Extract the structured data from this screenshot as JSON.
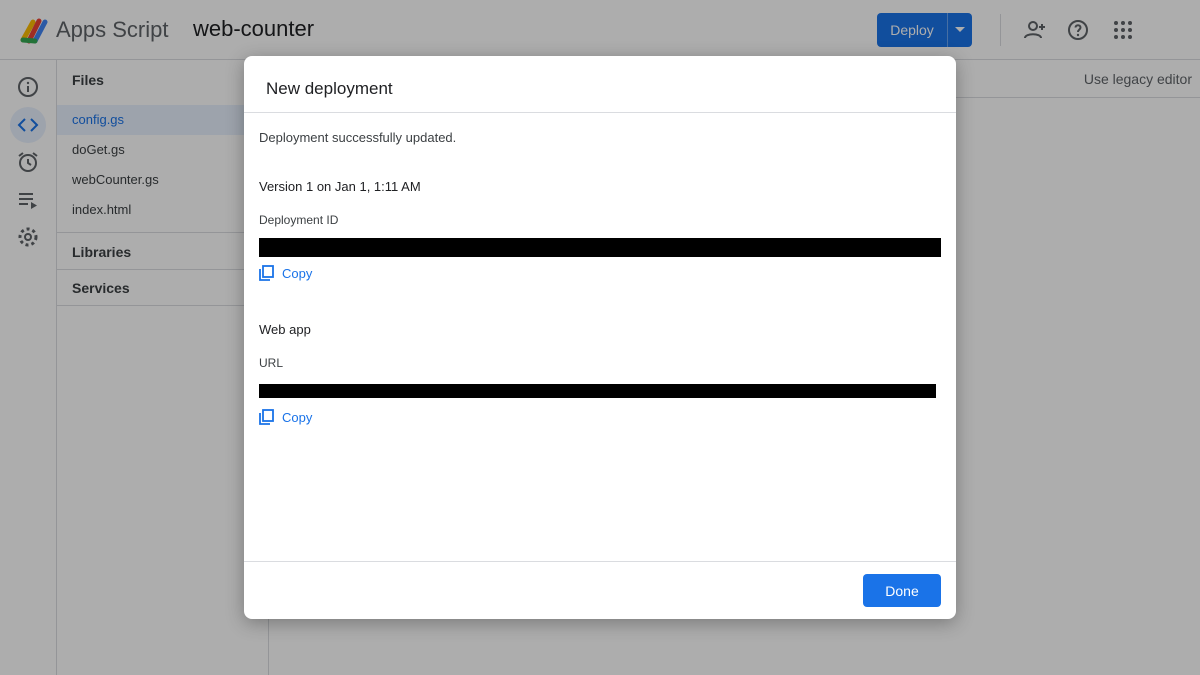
{
  "header": {
    "app_name": "Apps Script",
    "project_name": "web-counter",
    "deploy_label": "Deploy",
    "icons": [
      "add-person-icon",
      "help-icon",
      "apps-grid-icon"
    ]
  },
  "rail": {
    "icons": [
      "info-icon",
      "code-icon",
      "alarm-icon",
      "executions-icon",
      "settings-icon"
    ]
  },
  "files_panel": {
    "files_heading": "Files",
    "files": [
      "config.gs",
      "doGet.gs",
      "webCounter.gs",
      "index.html"
    ],
    "libraries_heading": "Libraries",
    "services_heading": "Services"
  },
  "editor": {
    "legacy_label": "Use legacy editor"
  },
  "dialog": {
    "title": "New deployment",
    "status": "Deployment successfully updated.",
    "version": "Version 1 on Jan 1, 1:11 AM",
    "deployment_id_label": "Deployment ID",
    "copy_label": "Copy",
    "web_app_heading": "Web app",
    "url_label": "URL",
    "done_label": "Done"
  },
  "colors": {
    "accent": "#1a73e8",
    "redaction": "#000000"
  }
}
